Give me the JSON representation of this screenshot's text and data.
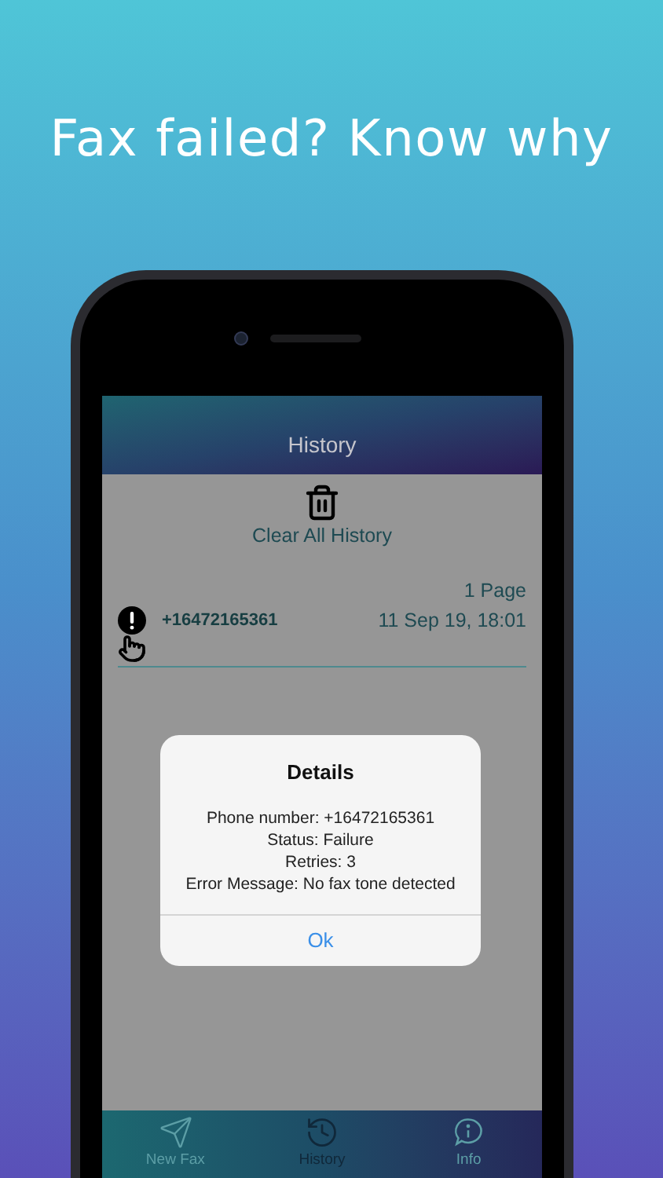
{
  "headline": "Fax failed? Know why",
  "screen": {
    "title": "History"
  },
  "clear_button": {
    "label": "Clear All History"
  },
  "history": [
    {
      "kind": "failed",
      "pages": "1 Page",
      "phone": "+16472165361",
      "datetime": "11 Sep 19, 18:01"
    }
  ],
  "dialog": {
    "title": "Details",
    "lines": [
      "Phone number: +16472165361",
      "Status: Failure",
      "Retries: 3",
      "Error Message: No fax tone detected"
    ],
    "button": "Ok"
  },
  "tabs": [
    {
      "kind": "send",
      "label": "New Fax",
      "selected": false
    },
    {
      "kind": "history",
      "label": "History",
      "selected": true
    },
    {
      "kind": "info",
      "label": "Info",
      "selected": false
    }
  ]
}
